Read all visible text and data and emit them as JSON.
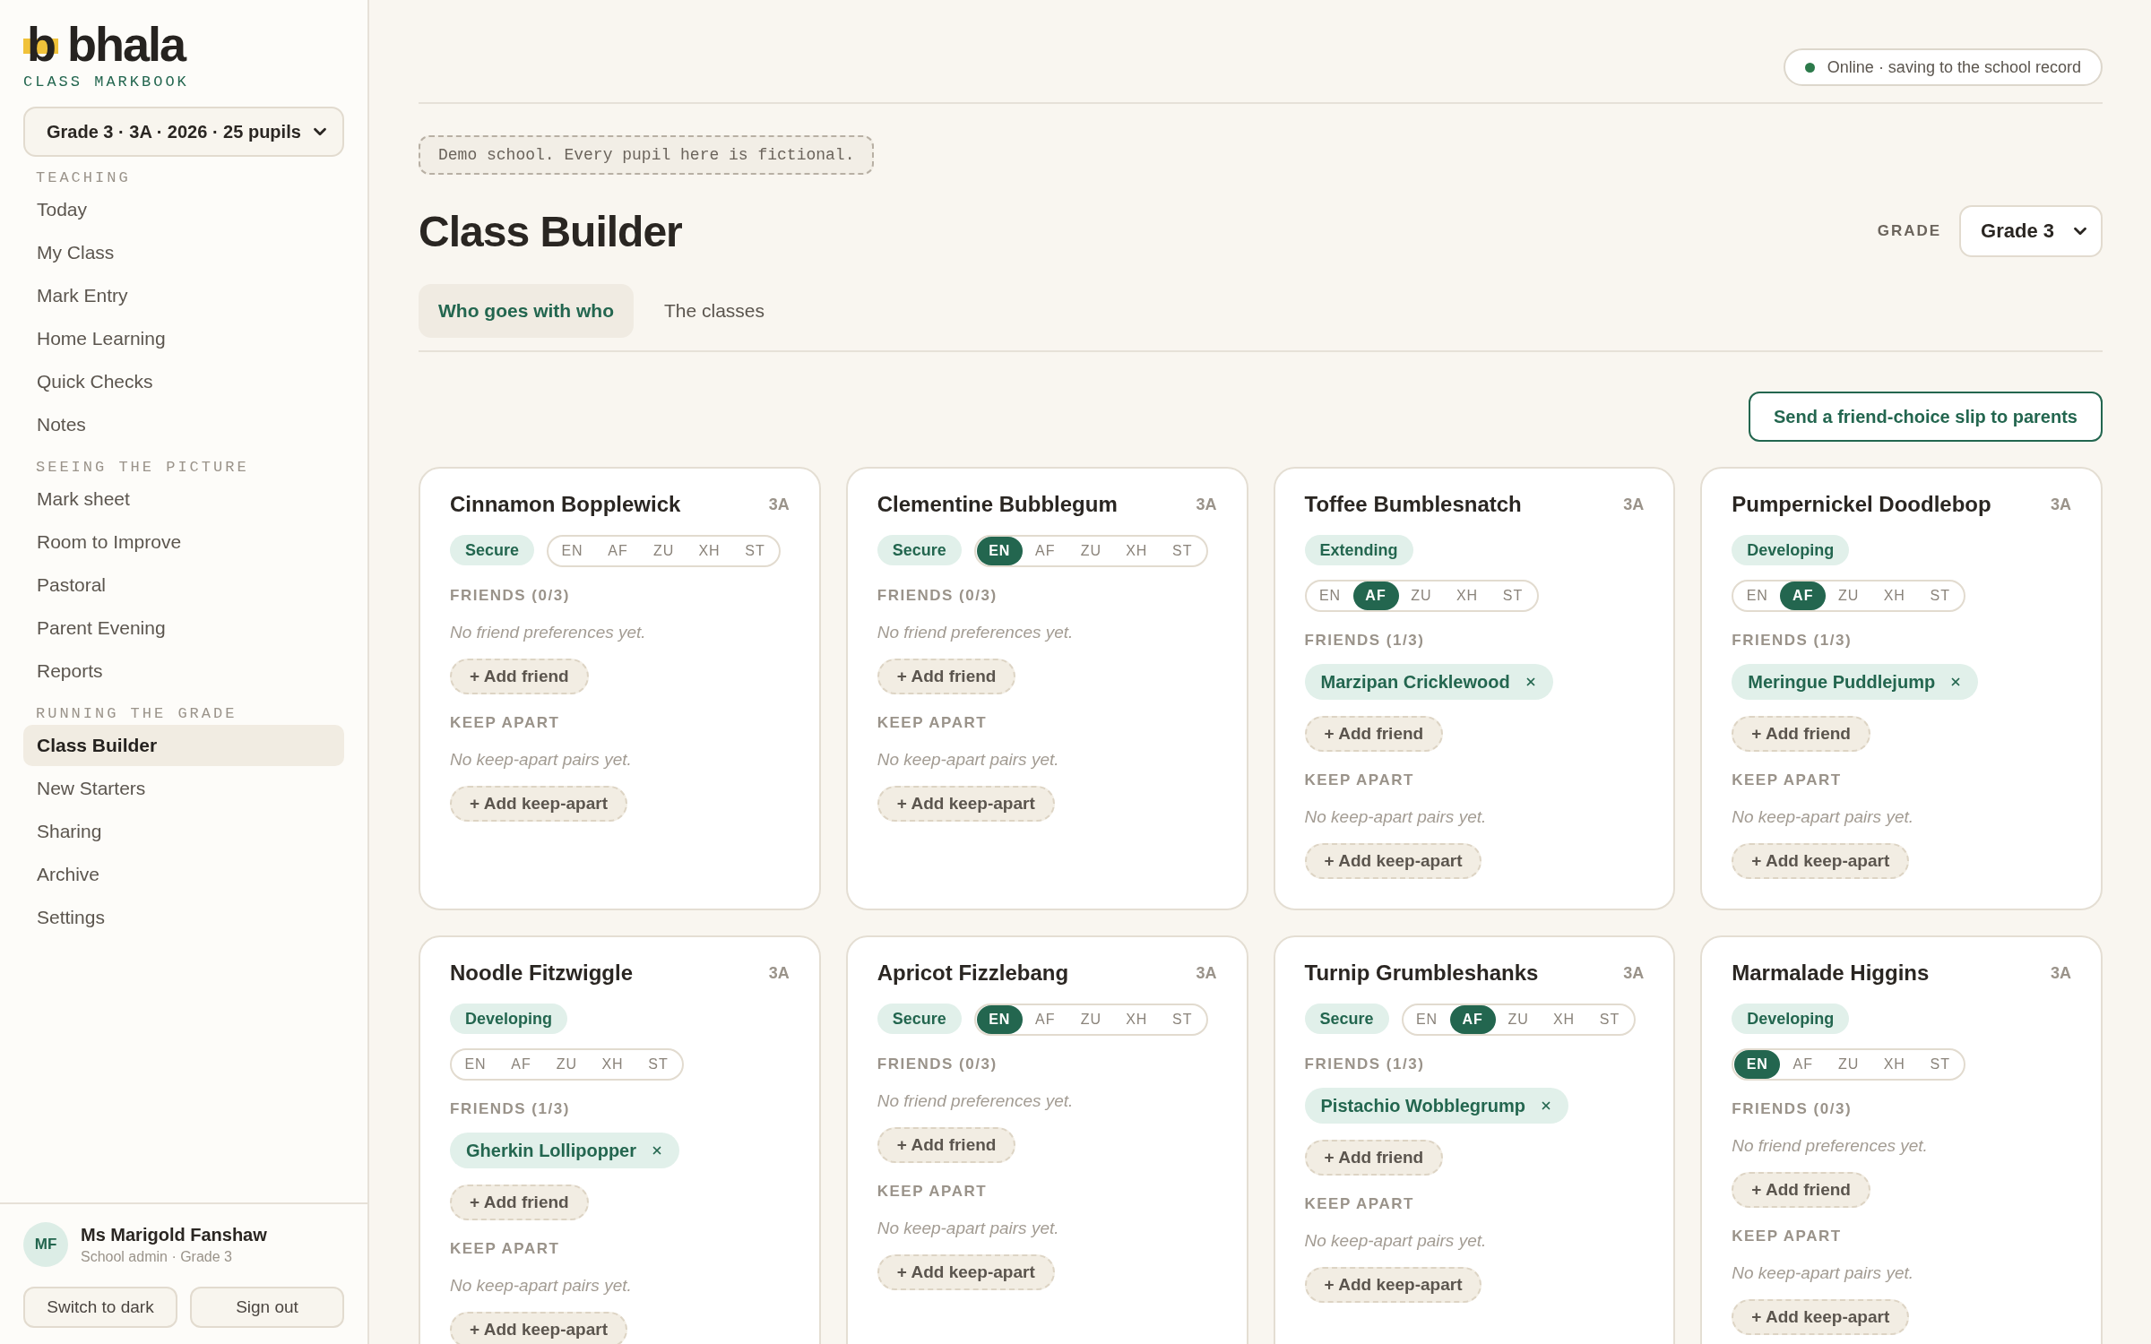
{
  "sidebar": {
    "logo": {
      "mark": "b",
      "name": "bhala",
      "tagline": "CLASS MARKBOOK"
    },
    "class_select": "Grade 3 · 3A · 2026 · 25 pupils",
    "sections": [
      {
        "heading": "TEACHING",
        "items": [
          {
            "label": "Today",
            "selected": false
          },
          {
            "label": "My Class",
            "selected": false
          },
          {
            "label": "Mark Entry",
            "selected": false
          },
          {
            "label": "Home Learning",
            "selected": false
          },
          {
            "label": "Quick Checks",
            "selected": false
          },
          {
            "label": "Notes",
            "selected": false
          }
        ]
      },
      {
        "heading": "SEEING THE PICTURE",
        "items": [
          {
            "label": "Mark sheet",
            "selected": false
          },
          {
            "label": "Room to Improve",
            "selected": false
          },
          {
            "label": "Pastoral",
            "selected": false
          },
          {
            "label": "Parent Evening",
            "selected": false
          },
          {
            "label": "Reports",
            "selected": false
          }
        ]
      },
      {
        "heading": "RUNNING THE GRADE",
        "items": [
          {
            "label": "Class Builder",
            "selected": true
          },
          {
            "label": "New Starters",
            "selected": false
          },
          {
            "label": "Sharing",
            "selected": false
          },
          {
            "label": "Archive",
            "selected": false
          },
          {
            "label": "Settings",
            "selected": false
          }
        ]
      }
    ],
    "user": {
      "initials": "MF",
      "name": "Ms Marigold Fanshaw",
      "role": "School admin · Grade 3"
    },
    "buttons": [
      "Switch to dark",
      "Sign out"
    ]
  },
  "status": {
    "text": "Online · saving to the school record",
    "online": true
  },
  "notice": "Demo school. Every pupil here is fictional.",
  "title": "Class Builder",
  "grade_filter": {
    "label": "GRADE",
    "value": "Grade 3"
  },
  "tabs": [
    {
      "label": "Who goes with who",
      "selected": true
    },
    {
      "label": "The classes",
      "selected": false
    }
  ],
  "send_button": "Send a friend-choice slip to parents",
  "cards": [
    {
      "name": "Cinnamon Bopplewick",
      "class": "3A",
      "level": "Secure",
      "languages": [
        {
          "code": "EN",
          "selected": false
        },
        {
          "code": "AF",
          "selected": false
        },
        {
          "code": "ZU",
          "selected": false
        },
        {
          "code": "XH",
          "selected": false
        },
        {
          "code": "ST",
          "selected": false
        }
      ],
      "friends_heading": "FRIENDS (0/3)",
      "friends_empty": "No friend preferences yet.",
      "add_friend": "+ Add friend",
      "keep_apart_heading": "KEEP APART",
      "keep_apart_empty": "No keep-apart pairs yet.",
      "add_keep_apart": "+ Add keep-apart"
    },
    {
      "name": "Clementine Bubblegum",
      "class": "3A",
      "level": "Secure",
      "languages": [
        {
          "code": "EN",
          "selected": true
        },
        {
          "code": "AF",
          "selected": false
        },
        {
          "code": "ZU",
          "selected": false
        },
        {
          "code": "XH",
          "selected": false
        },
        {
          "code": "ST",
          "selected": false
        }
      ],
      "friends_heading": "FRIENDS (0/3)",
      "friends_empty": "No friend preferences yet.",
      "add_friend": "+ Add friend",
      "keep_apart_heading": "KEEP APART",
      "keep_apart_empty": "No keep-apart pairs yet.",
      "add_keep_apart": "+ Add keep-apart"
    },
    {
      "name": "Toffee Bumblesnatch",
      "class": "3A",
      "level": "Extending",
      "languages": [
        {
          "code": "EN",
          "selected": false
        },
        {
          "code": "AF",
          "selected": true
        },
        {
          "code": "ZU",
          "selected": false
        },
        {
          "code": "XH",
          "selected": false
        },
        {
          "code": "ST",
          "selected": false
        }
      ],
      "friends_heading": "FRIENDS (1/3)",
      "friends": [
        "Marzipan Cricklewood"
      ],
      "add_friend": "+ Add friend",
      "keep_apart_heading": "KEEP APART",
      "keep_apart_empty": "No keep-apart pairs yet.",
      "add_keep_apart": "+ Add keep-apart"
    },
    {
      "name": "Pumpernickel Doodlebop",
      "class": "3A",
      "level": "Developing",
      "languages": [
        {
          "code": "EN",
          "selected": false
        },
        {
          "code": "AF",
          "selected": true
        },
        {
          "code": "ZU",
          "selected": false
        },
        {
          "code": "XH",
          "selected": false
        },
        {
          "code": "ST",
          "selected": false
        }
      ],
      "friends_heading": "FRIENDS (1/3)",
      "friends": [
        "Meringue Puddlejump"
      ],
      "add_friend": "+ Add friend",
      "keep_apart_heading": "KEEP APART",
      "keep_apart_empty": "No keep-apart pairs yet.",
      "add_keep_apart": "+ Add keep-apart"
    },
    {
      "name": "Noodle Fitzwiggle",
      "class": "3A",
      "level": "Developing",
      "languages": [
        {
          "code": "EN",
          "selected": false
        },
        {
          "code": "AF",
          "selected": false
        },
        {
          "code": "ZU",
          "selected": false
        },
        {
          "code": "XH",
          "selected": false
        },
        {
          "code": "ST",
          "selected": false
        }
      ],
      "friends_heading": "FRIENDS (1/3)",
      "friends": [
        "Gherkin Lollipopper"
      ],
      "add_friend": "+ Add friend",
      "keep_apart_heading": "KEEP APART",
      "keep_apart_empty": "No keep-apart pairs yet.",
      "add_keep_apart": "+ Add keep-apart"
    },
    {
      "name": "Apricot Fizzlebang",
      "class": "3A",
      "level": "Secure",
      "languages": [
        {
          "code": "EN",
          "selected": true
        },
        {
          "code": "AF",
          "selected": false
        },
        {
          "code": "ZU",
          "selected": false
        },
        {
          "code": "XH",
          "selected": false
        },
        {
          "code": "ST",
          "selected": false
        }
      ],
      "friends_heading": "FRIENDS (0/3)",
      "friends_empty": "No friend preferences yet.",
      "add_friend": "+ Add friend",
      "keep_apart_heading": "KEEP APART",
      "keep_apart_empty": "No keep-apart pairs yet.",
      "add_keep_apart": "+ Add keep-apart"
    },
    {
      "name": "Turnip Grumbleshanks",
      "class": "3A",
      "level": "Secure",
      "languages": [
        {
          "code": "EN",
          "selected": false
        },
        {
          "code": "AF",
          "selected": true
        },
        {
          "code": "ZU",
          "selected": false
        },
        {
          "code": "XH",
          "selected": false
        },
        {
          "code": "ST",
          "selected": false
        }
      ],
      "friends_heading": "FRIENDS (1/3)",
      "friends": [
        "Pistachio Wobblegrump"
      ],
      "add_friend": "+ Add friend",
      "keep_apart_heading": "KEEP APART",
      "keep_apart_empty": "No keep-apart pairs yet.",
      "add_keep_apart": "+ Add keep-apart"
    },
    {
      "name": "Marmalade Higgins",
      "class": "3A",
      "level": "Developing",
      "languages": [
        {
          "code": "EN",
          "selected": true
        },
        {
          "code": "AF",
          "selected": false
        },
        {
          "code": "ZU",
          "selected": false
        },
        {
          "code": "XH",
          "selected": false
        },
        {
          "code": "ST",
          "selected": false
        }
      ],
      "friends_heading": "FRIENDS (0/3)",
      "friends_empty": "No friend preferences yet.",
      "add_friend": "+ Add friend",
      "keep_apart_heading": "KEEP APART",
      "keep_apart_empty": "No keep-apart pairs yet.",
      "add_keep_apart": "+ Add keep-apart"
    }
  ]
}
